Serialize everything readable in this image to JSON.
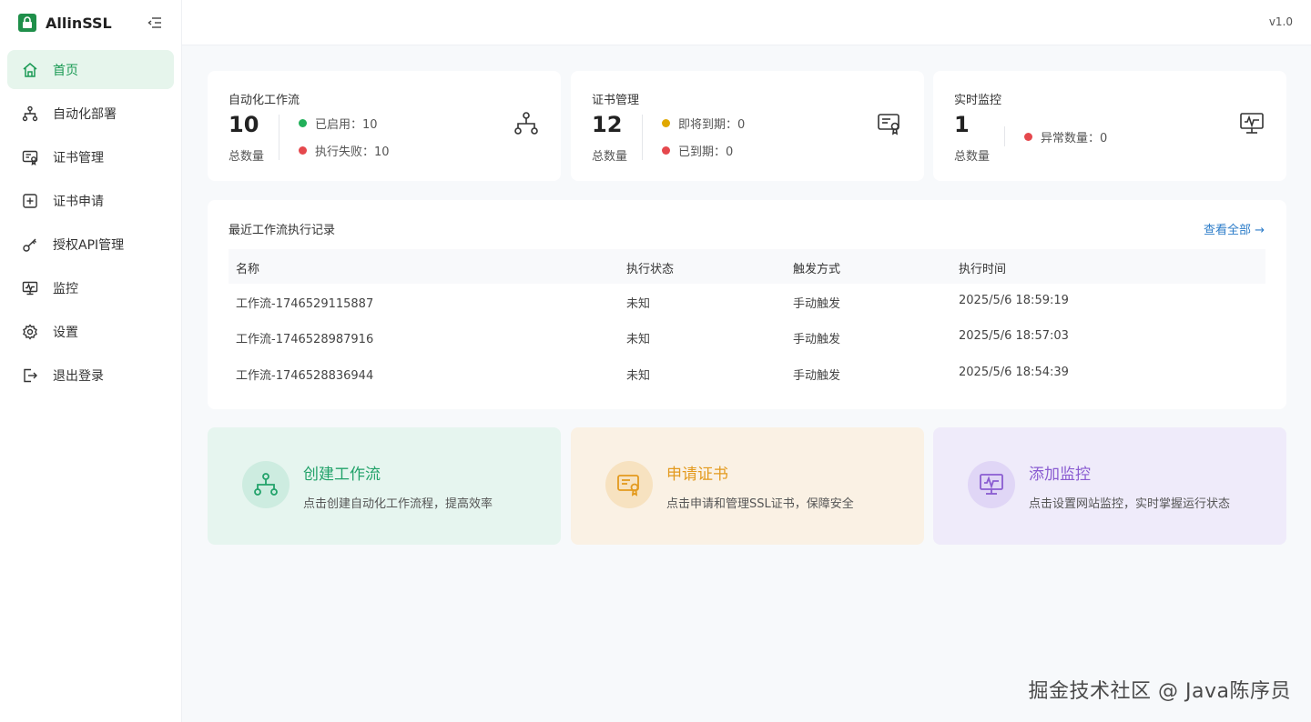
{
  "app": {
    "name": "AllinSSL",
    "version": "v1.0"
  },
  "sidebar": {
    "items": [
      {
        "label": "首页",
        "icon": "home-icon",
        "active": true
      },
      {
        "label": "自动化部署",
        "icon": "workflow-icon"
      },
      {
        "label": "证书管理",
        "icon": "certificate-icon"
      },
      {
        "label": "证书申请",
        "icon": "plus-square-icon"
      },
      {
        "label": "授权API管理",
        "icon": "api-key-icon"
      },
      {
        "label": "监控",
        "icon": "monitor-icon"
      },
      {
        "label": "设置",
        "icon": "gear-icon"
      },
      {
        "label": "退出登录",
        "icon": "logout-icon"
      }
    ]
  },
  "stats": {
    "workflow": {
      "title": "自动化工作流",
      "count": "10",
      "count_label": "总数量",
      "line1": "已启用：10",
      "line2": "执行失败：10"
    },
    "certs": {
      "title": "证书管理",
      "count": "12",
      "count_label": "总数量",
      "line1": "即将到期：0",
      "line2": "已到期：0"
    },
    "monitor": {
      "title": "实时监控",
      "count": "1",
      "count_label": "总数量",
      "line1": "异常数量：0"
    }
  },
  "recent": {
    "title": "最近工作流执行记录",
    "view_all": "查看全部 →",
    "headers": [
      "名称",
      "执行状态",
      "触发方式",
      "执行时间"
    ],
    "rows": [
      [
        "工作流-1746529115887",
        "未知",
        "手动触发",
        "2025/5/6 18:59:19"
      ],
      [
        "工作流-1746528987916",
        "未知",
        "手动触发",
        "2025/5/6 18:57:03"
      ],
      [
        "工作流-1746528836944",
        "未知",
        "手动触发",
        "2025/5/6 18:54:39"
      ]
    ]
  },
  "actions": {
    "create_workflow": {
      "title": "创建工作流",
      "desc": "点击创建自动化工作流程，提高效率"
    },
    "apply_cert": {
      "title": "申请证书",
      "desc": "点击申请和管理SSL证书，保障安全"
    },
    "add_monitor": {
      "title": "添加监控",
      "desc": "点击设置网站监控，实时掌握运行状态"
    }
  },
  "colors": {
    "green": "#22b05a",
    "red": "#e5484d",
    "yellow": "#e0a800",
    "accent": "#1a9a54",
    "link": "#2d7dc9",
    "purple": "#8a5cd1",
    "orange": "#e39a1e"
  },
  "watermark": "掘金技术社区 @ Java陈序员"
}
